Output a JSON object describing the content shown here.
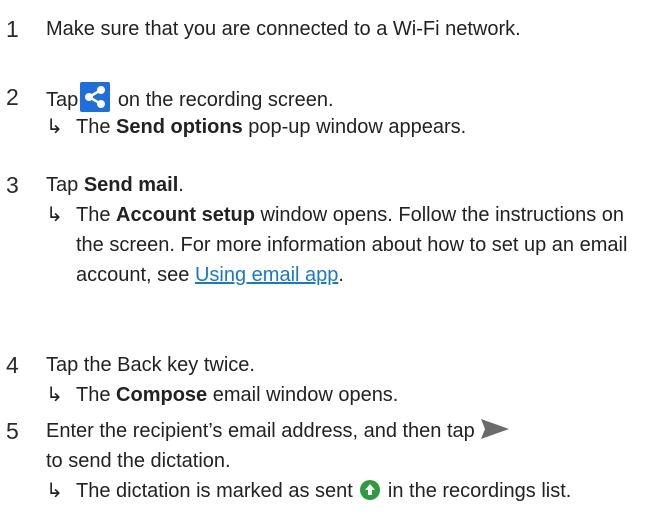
{
  "steps": [
    {
      "number": "1",
      "text": "Make sure that you are connected to a Wi-Fi network."
    },
    {
      "number": "2",
      "text_before": "Tap",
      "icon": "share-icon",
      "text_after": "on the recording screen.",
      "result_pre": "The ",
      "result_bold": "Send options",
      "result_post": " pop-up window appears."
    },
    {
      "number": "3",
      "text_before": "Tap ",
      "text_bold": "Send mail",
      "text_after": ".",
      "result_pre": "The ",
      "result_bold": "Account setup",
      "result_mid": " window opens. Follow the instructions on the screen. For more information about how to set up an email account, see ",
      "result_link": "Using email app",
      "result_post": "."
    },
    {
      "number": "4",
      "text": "Tap the Back key twice.",
      "result_pre": "The ",
      "result_bold": "Compose",
      "result_post": " email window opens."
    },
    {
      "number": "5",
      "text_before": "Enter the recipient’s email address, and then tap",
      "icon": "send-icon",
      "text_line2": "to send the dictation.",
      "result_pre": "The dictation is marked as sent",
      "result_icon": "sent-icon",
      "result_post": " in the recordings list."
    }
  ],
  "result_arrow": "↳",
  "colors": {
    "text": "#222222",
    "link": "#1a78c9",
    "share_icon_bg": "#1e6fd9",
    "send_icon": "#6b6b6b",
    "sent_icon": "#2e9b3f"
  }
}
